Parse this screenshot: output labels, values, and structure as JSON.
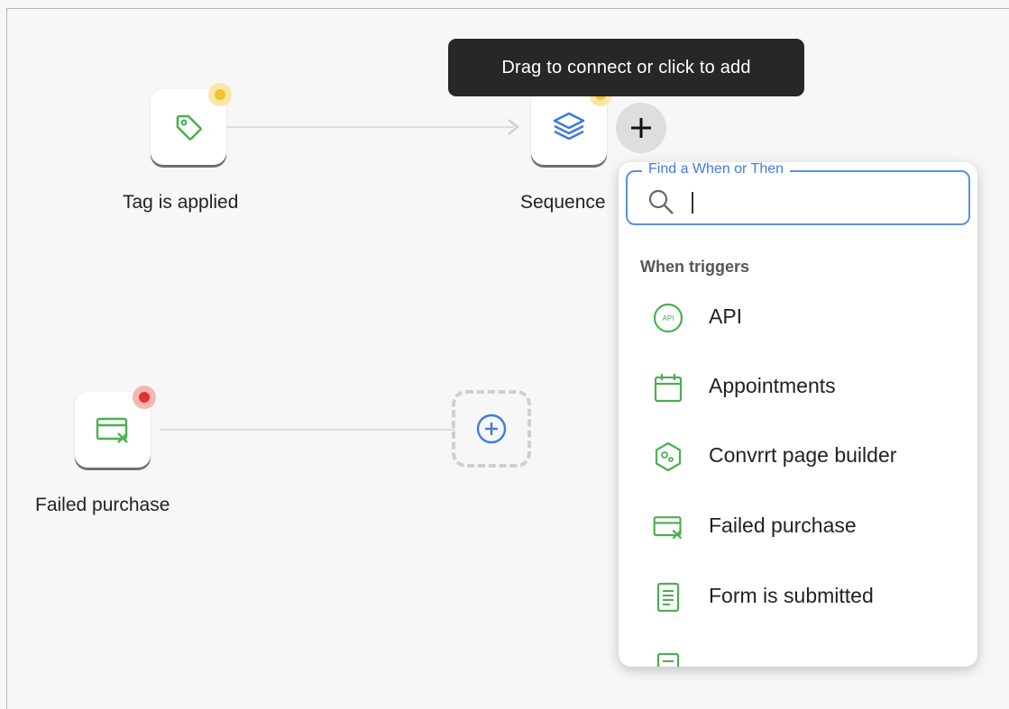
{
  "canvas": {
    "tooltip": "Drag to connect or click to add",
    "nodes": [
      {
        "id": "tag",
        "label": "Tag is applied",
        "icon": "tag-icon",
        "status": "warning"
      },
      {
        "id": "sequence",
        "label": "Sequence",
        "icon": "layers-icon",
        "status": "warning"
      },
      {
        "id": "failed",
        "label": "Failed purchase",
        "icon": "failed-card-icon",
        "status": "error"
      }
    ],
    "add_button_icon": "plus-icon",
    "placeholder_add_icon": "plus-circle-icon"
  },
  "picker": {
    "search_legend": "Find a When or Then",
    "search_value": "",
    "search_placeholder": "",
    "section_title": "When triggers",
    "items": [
      {
        "label": "API",
        "icon": "api-icon"
      },
      {
        "label": "Appointments",
        "icon": "calendar-icon"
      },
      {
        "label": "Convrrt page builder",
        "icon": "page-builder-icon"
      },
      {
        "label": "Failed purchase",
        "icon": "failed-card-icon"
      },
      {
        "label": "Form is submitted",
        "icon": "form-icon"
      },
      {
        "label": "",
        "icon": "form-icon"
      }
    ]
  },
  "colors": {
    "accent_green": "#4caf50",
    "accent_blue": "#3f7be0",
    "warning_yellow": "#f2c12e",
    "error_red": "#e0342a",
    "tooltip_bg": "#272727"
  }
}
